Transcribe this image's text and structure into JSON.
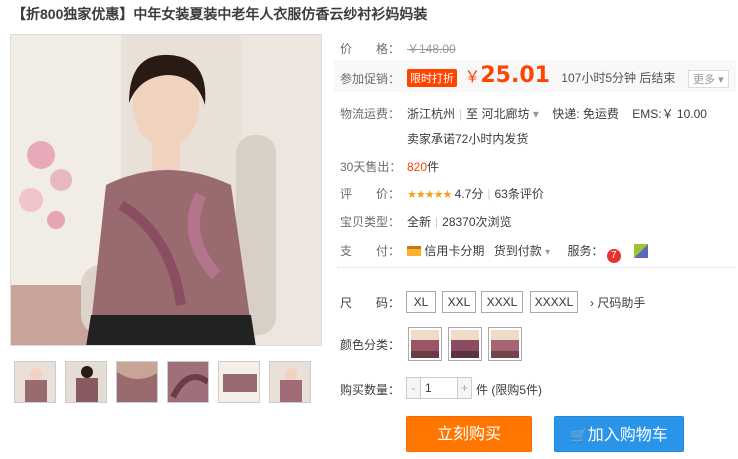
{
  "title": "【折800独家优惠】中年女装夏装中老年人衣服仿香云纱衬衫妈妈装",
  "price": {
    "label": "价　　格：",
    "original": "￥148.00"
  },
  "promo": {
    "label": "参加促销：",
    "badge": "限时打折",
    "currency": "￥",
    "price": "25.01",
    "countdown": "107小时5分钟 后结束",
    "more": "更多"
  },
  "shipping": {
    "label": "物流运费：",
    "from": "浙江杭州",
    "to_prefix": "至",
    "to": "河北廊坊",
    "express": "快递: 免运费",
    "ems": "EMS:￥ 10.00",
    "promise": "卖家承诺72小时内发货"
  },
  "sales": {
    "label": "30天售出：",
    "count": "820",
    "unit": "件"
  },
  "rating": {
    "label": "评　　价：",
    "stars": "★★★★★",
    "score": "4.7分",
    "reviews": "63条评价"
  },
  "type": {
    "label": "宝贝类型：",
    "value": "全新",
    "views": "28370次浏览"
  },
  "payment": {
    "label": "支　　付：",
    "installment": "信用卡分期",
    "cod": "货到付款",
    "service_label": "服务："
  },
  "sizes": {
    "label": "尺　　码：",
    "options": [
      "XL",
      "XXL",
      "XXXL",
      "XXXXL"
    ],
    "helper": "尺码助手"
  },
  "colors": {
    "label": "颜色分类："
  },
  "quantity": {
    "label": "购买数量：",
    "value": "1",
    "unit": "件 (限购5件)"
  },
  "buttons": {
    "buy": "立刻购买",
    "cart": "加入购物车"
  },
  "colors_theme": {
    "accent": "#ff4400",
    "buy": "#ff7700",
    "cart": "#2a95e8"
  }
}
